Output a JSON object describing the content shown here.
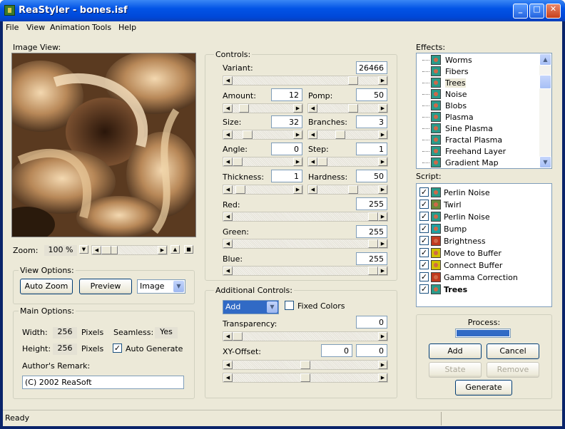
{
  "window": {
    "title": "ReaStyler - bones.isf",
    "minimize": "_",
    "maximize": "□",
    "close": "✕"
  },
  "menu": [
    "File",
    "View",
    "Animation",
    "Tools",
    "Help"
  ],
  "image_view": {
    "label": "Image View:",
    "zoom_label": "Zoom:",
    "zoom_value": "100 %"
  },
  "view_options": {
    "label": "View Options:",
    "auto_zoom": "Auto Zoom",
    "preview": "Preview",
    "mode": "Image"
  },
  "main_options": {
    "label": "Main Options:",
    "width_label": "Width:",
    "width": "256",
    "pixels1": "Pixels",
    "height_label": "Height:",
    "height": "256",
    "pixels2": "Pixels",
    "seamless_label": "Seamless:",
    "seamless": "Yes",
    "auto_generate": "Auto Generate",
    "auto_generate_checked": true,
    "remark_label": "Author's Remark:",
    "remark": "(C) 2002 ReaSoft"
  },
  "controls": {
    "label": "Controls:",
    "variant_label": "Variant:",
    "variant": "26466",
    "variant_level": 0.85,
    "amount_label": "Amount:",
    "amount": "12",
    "amount_level": 0.12,
    "pomp_label": "Pomp:",
    "pomp": "50",
    "pomp_level": 0.6,
    "size_label": "Size:",
    "size": "32",
    "size_level": 0.2,
    "branches_label": "Branches:",
    "branches": "3",
    "branches_level": 0.35,
    "angle_label": "Angle:",
    "angle": "0",
    "angle_level": 0.0,
    "step_label": "Step:",
    "step": "1",
    "step_level": 0.0,
    "thickness_label": "Thickness:",
    "thickness": "1",
    "thickness_level": 0.05,
    "hardness_label": "Hardness:",
    "hardness": "50",
    "hardness_level": 0.6,
    "red_label": "Red:",
    "red": "255",
    "red_level": 1.0,
    "green_label": "Green:",
    "green": "255",
    "green_level": 1.0,
    "blue_label": "Blue:",
    "blue": "255",
    "blue_level": 1.0
  },
  "additional": {
    "label": "Additional Controls:",
    "blend": "Add",
    "fixed_colors": "Fixed Colors",
    "transparency_label": "Transparency:",
    "transparency": "0",
    "xy_label": "XY-Offset:",
    "x": "0",
    "y": "0"
  },
  "effects": {
    "label": "Effects:",
    "items": [
      "Worms",
      "Fibers",
      "Trees",
      "Noise",
      "Blobs",
      "Plasma",
      "Sine Plasma",
      "Fractal Plasma",
      "Freehand Layer",
      "Gradient Map"
    ],
    "selected": "Trees"
  },
  "script": {
    "label": "Script:",
    "items": [
      "Perlin Noise",
      "Twirl",
      "Perlin Noise",
      "Bump",
      "Brightness",
      "Move to Buffer",
      "Connect Buffer",
      "Gamma Correction",
      "Trees"
    ]
  },
  "process": {
    "label": "Process:",
    "add": "Add",
    "cancel": "Cancel",
    "state": "State",
    "remove": "Remove",
    "generate": "Generate"
  },
  "status": "Ready",
  "colors": {
    "title_blue": "#0054e3",
    "face": "#ece9d8",
    "progress": "#316ac5"
  }
}
